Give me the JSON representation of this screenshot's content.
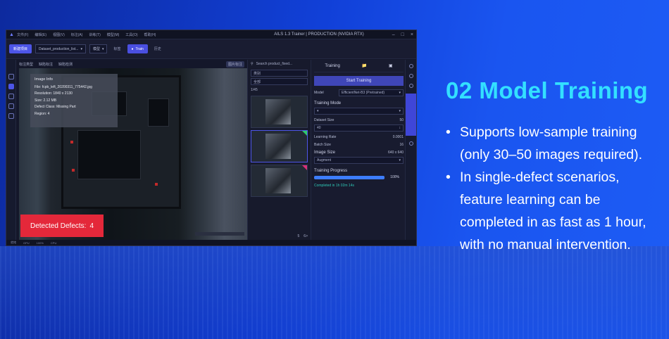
{
  "window": {
    "title": "AILS 1.3 Trainer | PRODUCTION (NVIDIA RTX)",
    "menu": [
      "文件(F)",
      "编辑(E)",
      "视图(V)",
      "标注(A)",
      "训练(T)",
      "模型(M)",
      "工具(O)",
      "帮助(H)"
    ]
  },
  "toolbar": {
    "new_project": "新建项目",
    "project_select": "Dataset_production_list...",
    "mode_select": "模型",
    "label": "标签",
    "train_button": "Train",
    "history": "历史"
  },
  "viewer": {
    "tabs": [
      "标注类型",
      "缺陷标注",
      "缺陷检测"
    ],
    "tag": "图片标注",
    "info": {
      "title": "Image Info",
      "file": "File: fcpb_left_20200311_775442.jpg",
      "resolution": "Resolution: 1840 x 2130",
      "size": "Size: 2.12 MB",
      "defect_class": "Defect Class: Missing Part",
      "region": "Region: 4"
    },
    "detected_label": "Detected Defects:",
    "detected_count": "4"
  },
  "thumbs": {
    "search_placeholder": "Search product_fixed...",
    "filter1": "类别",
    "filter2": "全部",
    "count": "1/45",
    "pager": [
      "5",
      "6>"
    ]
  },
  "settings": {
    "tabs": [
      "Training",
      "Folder",
      "Image"
    ],
    "start": "Start Training",
    "model_label": "Model",
    "model_value": "EfficientNet-B3 (Pretrained)",
    "training_mode": "Training Mode",
    "dataset_label": "Dataset Size",
    "dataset_count": "50",
    "epochs": "40",
    "learning_rate_label": "Learning Rate",
    "learning_rate": "0.0001",
    "batch_label": "Batch Size",
    "batch_value": "16",
    "image_size_label": "Image Size",
    "image_size": "640 x 640",
    "aug_label": "Augment",
    "progress_label": "Training Progress",
    "progress_pct": "100%",
    "progress_fraction": 1.0,
    "completed": "Completed in 1h 02m 14s"
  },
  "statusbar": [
    "就绪",
    "GPU",
    "100%",
    "CPU"
  ],
  "headline": "02 Model Training",
  "bullets": [
    "Supports low-sample training (only 30–50 images required).",
    "In single-defect scenarios, feature learning can be completed in as fast as 1 hour, with no manual intervention."
  ],
  "colors": {
    "accent_headline": "#33e0ff",
    "defect_red": "#e4283a",
    "primary": "#4d55e8"
  }
}
